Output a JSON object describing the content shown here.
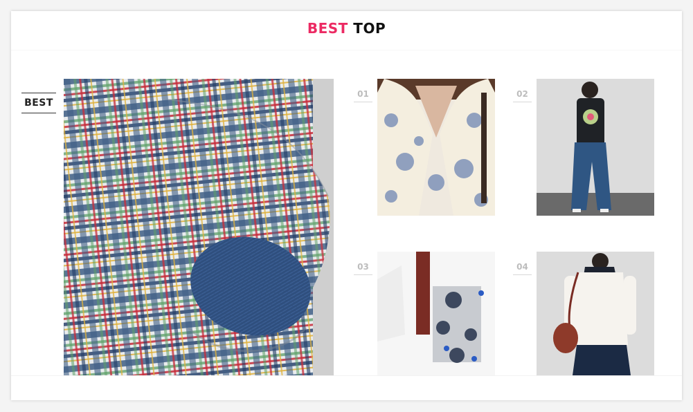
{
  "header": {
    "title_accent": "BEST",
    "title_rest": "TOP"
  },
  "badge": {
    "label": "BEST"
  },
  "hero": {
    "image": "plaid-shirt-with-denim-elbow-patch"
  },
  "items": [
    {
      "number": "01",
      "image": "floral-ruffle-blouse"
    },
    {
      "number": "02",
      "image": "graphic-tee-wide-jeans"
    },
    {
      "number": "03",
      "image": "printed-white-tee"
    },
    {
      "number": "04",
      "image": "white-knit-collar-top"
    }
  ],
  "colors": {
    "accent": "#ec2a63",
    "title_dark": "#111111",
    "number_gray": "#bdbdbd"
  }
}
